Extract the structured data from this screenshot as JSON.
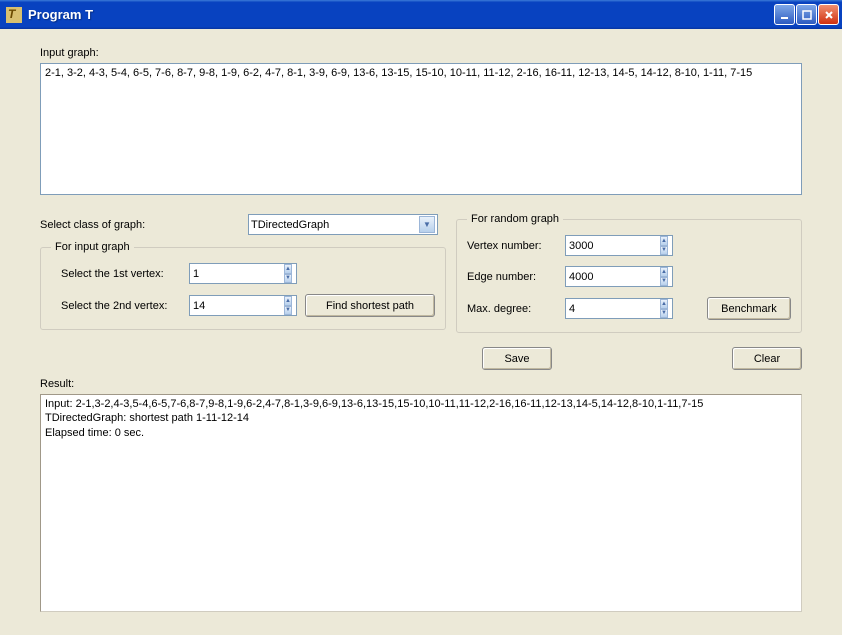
{
  "window": {
    "title": "Program T"
  },
  "input_graph": {
    "label": "Input graph:",
    "value": "2-1, 3-2, 4-3, 5-4, 6-5, 7-6, 8-7, 9-8, 1-9, 6-2, 4-7, 8-1, 3-9, 6-9, 13-6, 13-15, 15-10, 10-11, 11-12, 2-16, 16-11, 12-13, 14-5, 14-12, 8-10, 1-11, 7-15"
  },
  "graph_class": {
    "label": "Select class of graph:",
    "value": "TDirectedGraph"
  },
  "input_group": {
    "legend": "For input graph",
    "vertex1_label": "Select the 1st vertex:",
    "vertex1_value": "1",
    "vertex2_label": "Select the 2nd vertex:",
    "vertex2_value": "14",
    "find_button": "Find shortest path"
  },
  "random_group": {
    "legend": "For random graph",
    "vertex_number_label": "Vertex number:",
    "vertex_number_value": "3000",
    "edge_number_label": "Edge number:",
    "edge_number_value": "4000",
    "max_degree_label": "Max. degree:",
    "max_degree_value": "4",
    "benchmark_button": "Benchmark"
  },
  "actions": {
    "save": "Save",
    "clear": "Clear"
  },
  "result": {
    "label": "Result:",
    "line1": "Input: 2-1,3-2,4-3,5-4,6-5,7-6,8-7,9-8,1-9,6-2,4-7,8-1,3-9,6-9,13-6,13-15,15-10,10-11,11-12,2-16,16-11,12-13,14-5,14-12,8-10,1-11,7-15",
    "line2": "TDirectedGraph: shortest path 1-11-12-14",
    "line3": "Elapsed time: 0 sec."
  }
}
